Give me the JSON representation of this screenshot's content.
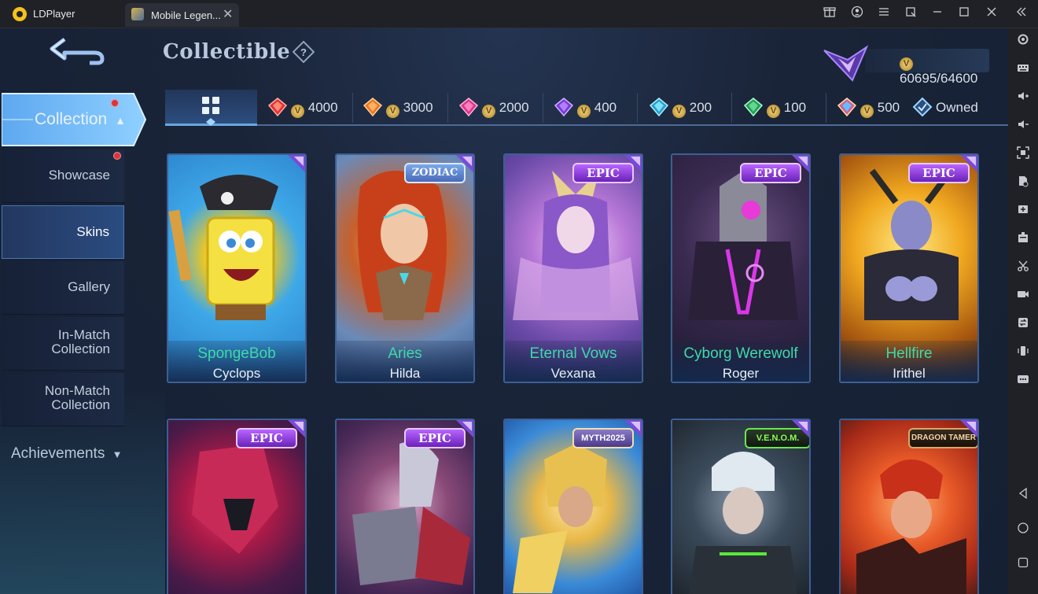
{
  "window": {
    "app_name": "LDPlayer",
    "tab_label": "Mobile Legen...",
    "tab_close": "✕"
  },
  "header": {
    "title": "Collectible",
    "currency": {
      "value": "60695/64600",
      "icon": "promo-diamond-coin-icon"
    }
  },
  "sidebar": {
    "collection_label": "Collection",
    "items": [
      {
        "label": "Showcase",
        "has_dot": true
      },
      {
        "label": "Skins",
        "active": true
      },
      {
        "label": "Gallery"
      },
      {
        "label": "In-Match\nCollection"
      },
      {
        "label": "Non-Match\nCollection"
      }
    ],
    "achievements_label": "Achievements"
  },
  "filters": [
    {
      "icon": "red-gem-icon",
      "cost": "4000"
    },
    {
      "icon": "orange-gem-icon",
      "cost": "3000"
    },
    {
      "icon": "pink-gem-icon",
      "cost": "2000"
    },
    {
      "icon": "purple-gem-icon",
      "cost": "400"
    },
    {
      "icon": "blue-gem-icon",
      "cost": "200"
    },
    {
      "icon": "green-gem-icon",
      "cost": "100"
    },
    {
      "icon": "rainbow-gem-icon",
      "cost": "500"
    },
    {
      "icon": "owned-diamond-icon",
      "label": "Owned"
    }
  ],
  "cards_row1": [
    {
      "badge": "",
      "skin": "SpongeBob",
      "hero": "Cyclops"
    },
    {
      "badge": "ZODIAC",
      "skin": "Aries",
      "hero": "Hilda"
    },
    {
      "badge": "EPIC",
      "skin": "Eternal Vows",
      "hero": "Vexana"
    },
    {
      "badge": "EPIC",
      "skin": "Cyborg Werewolf",
      "hero": "Roger"
    },
    {
      "badge": "EPIC",
      "skin": "Hellfire",
      "hero": "Irithel"
    }
  ],
  "cards_row2": [
    {
      "badge": "EPIC"
    },
    {
      "badge": "EPIC"
    },
    {
      "badge": "MYTH2025"
    },
    {
      "badge": "V.E.N.O.M."
    },
    {
      "badge": "DRAGON TAMER"
    }
  ],
  "colors": {
    "accent_blue": "#4a77b3",
    "skin_name_green": "#3fd9a9",
    "epic_purple": "#8a3ad8",
    "notification_red": "#d8363e"
  }
}
